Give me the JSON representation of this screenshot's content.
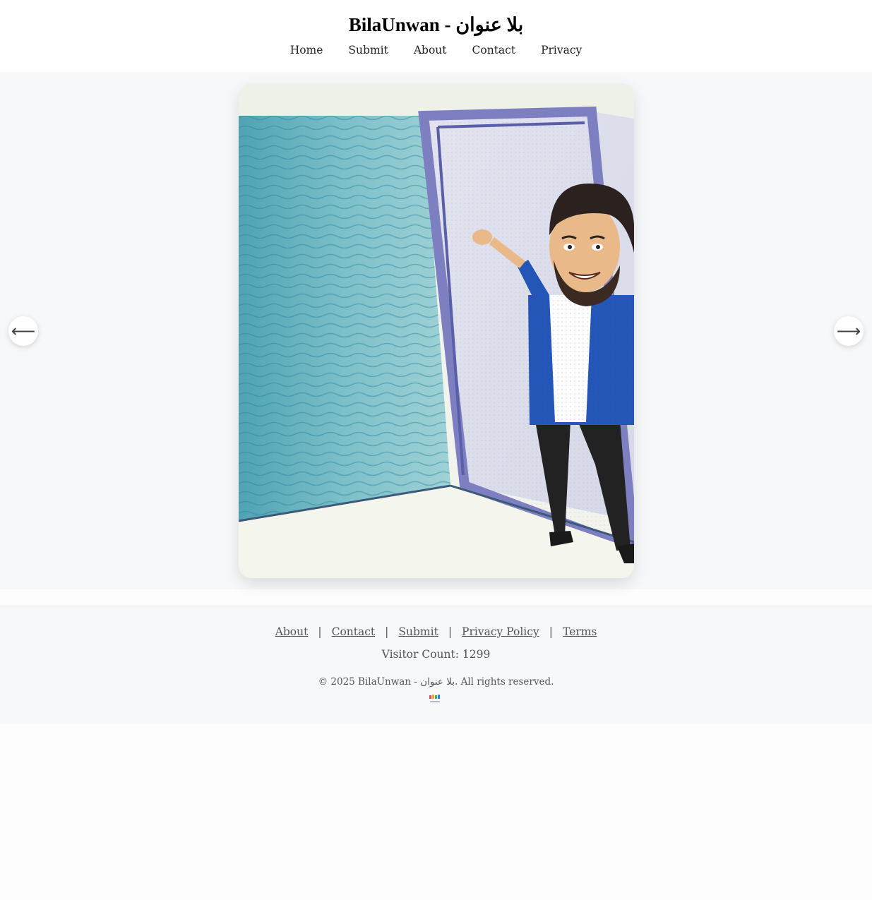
{
  "site": {
    "title": "BilaUnwan - بلا عنوان"
  },
  "nav": {
    "items": [
      {
        "label": "Home"
      },
      {
        "label": "Submit"
      },
      {
        "label": "About"
      },
      {
        "label": "Contact"
      },
      {
        "label": "Privacy"
      }
    ]
  },
  "gallery": {
    "prev_arrow": "⟵",
    "next_arrow": "⟶"
  },
  "footer": {
    "links": [
      {
        "label": "About"
      },
      {
        "label": "Contact"
      },
      {
        "label": "Submit"
      },
      {
        "label": "Privacy Policy"
      },
      {
        "label": "Terms"
      }
    ],
    "separator": "|",
    "visitor_count": "Visitor Count: 1299",
    "copyright": "© 2025 BilaUnwan - بلا عنوان. All rights reserved.",
    "logo_text": "بلا عنوان"
  }
}
